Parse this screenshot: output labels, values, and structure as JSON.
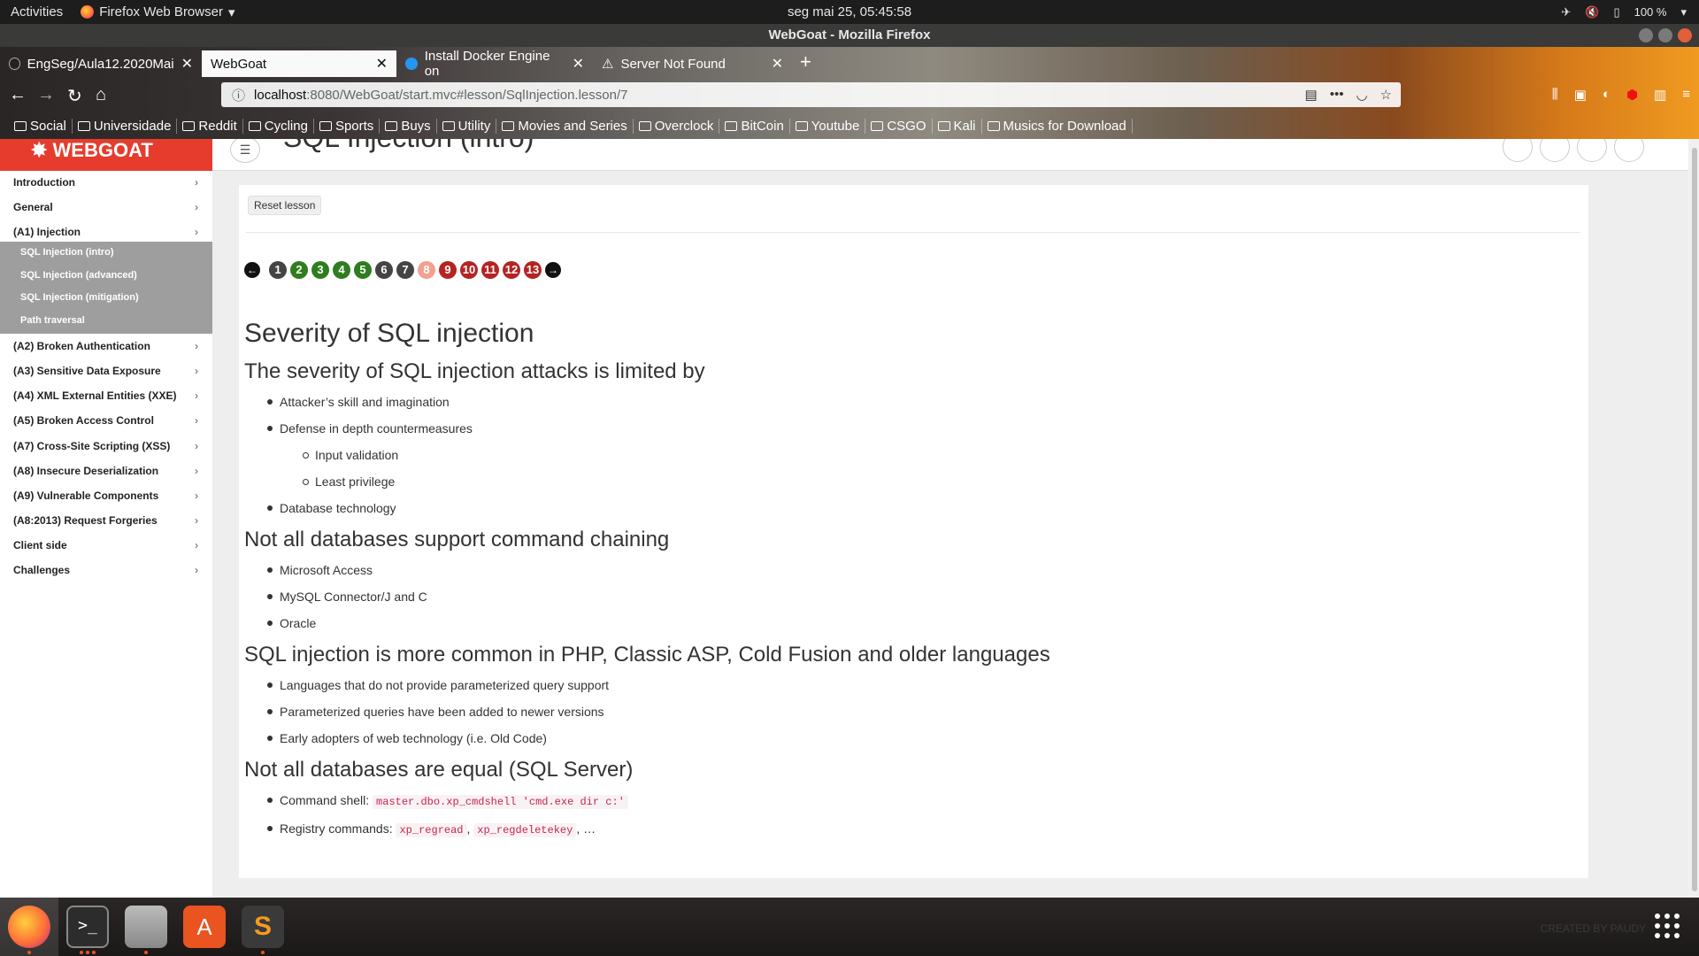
{
  "system_bar": {
    "activities": "Activities",
    "app_name": "Firefox Web Browser",
    "clock": "seg mai 25, 05:45:58",
    "battery": "100 %"
  },
  "window": {
    "title": "WebGoat - Mozilla Firefox"
  },
  "tabs": [
    {
      "label": "EngSeg/Aula12.2020Mai"
    },
    {
      "label": "WebGoat"
    },
    {
      "label": "Install Docker Engine on"
    },
    {
      "label": "Server Not Found"
    }
  ],
  "url": {
    "host": "localhost",
    "path": ":8080/WebGoat/start.mvc#lesson/SqlInjection.lesson/7"
  },
  "bookmarks": [
    "Social",
    "Universidade",
    "Reddit",
    "Cycling",
    "Sports",
    "Buys",
    "Utility",
    "Movies and Series",
    "Overclock",
    "BitCoin",
    "Youtube",
    "CSGO",
    "Kali",
    "Musics for Download"
  ],
  "sidebar": {
    "items": [
      {
        "label": "Introduction"
      },
      {
        "label": "General"
      },
      {
        "label": "(A1) Injection"
      },
      {
        "label": "(A2) Broken Authentication"
      },
      {
        "label": "(A3) Sensitive Data Exposure"
      },
      {
        "label": "(A4) XML External Entities (XXE)"
      },
      {
        "label": "(A5) Broken Access Control"
      },
      {
        "label": "(A7) Cross-Site Scripting (XSS)"
      },
      {
        "label": "(A8) Insecure Deserialization"
      },
      {
        "label": "(A9) Vulnerable Components"
      },
      {
        "label": "(A8:2013) Request Forgeries"
      },
      {
        "label": "Client side"
      },
      {
        "label": "Challenges"
      }
    ],
    "subitems": [
      {
        "label": "SQL Injection (intro)"
      },
      {
        "label": "SQL Injection (advanced)"
      },
      {
        "label": "SQL Injection (mitigation)"
      },
      {
        "label": "Path traversal"
      }
    ]
  },
  "lesson": {
    "title": "SQL Injection (intro)",
    "reset_label": "Reset lesson",
    "pages": [
      {
        "n": "1",
        "color": "#444444"
      },
      {
        "n": "2",
        "color": "#2e7d1e"
      },
      {
        "n": "3",
        "color": "#2e7d1e"
      },
      {
        "n": "4",
        "color": "#2e7d1e"
      },
      {
        "n": "5",
        "color": "#2e7d1e"
      },
      {
        "n": "6",
        "color": "#444444"
      },
      {
        "n": "7",
        "color": "#444444"
      },
      {
        "n": "8",
        "color": "#f2a08f"
      },
      {
        "n": "9",
        "color": "#b52323"
      },
      {
        "n": "10",
        "color": "#b52323"
      },
      {
        "n": "11",
        "color": "#b52323"
      },
      {
        "n": "12",
        "color": "#b52323"
      },
      {
        "n": "13",
        "color": "#b52323"
      }
    ]
  },
  "article": {
    "h2": "Severity of SQL injection",
    "s1": {
      "heading": "The severity of SQL injection attacks is limited by",
      "b1": "Attacker’s skill and imagination",
      "b2": "Defense in depth countermeasures",
      "b2a": "Input validation",
      "b2b": "Least privilege",
      "b3": "Database technology"
    },
    "s2": {
      "heading": "Not all databases support command chaining",
      "b1": "Microsoft Access",
      "b2": "MySQL Connector/J and C",
      "b3": "Oracle"
    },
    "s3": {
      "heading": "SQL injection is more common in PHP, Classic ASP, Cold Fusion and older languages",
      "b1": "Languages that do not provide parameterized query support",
      "b2": "Parameterized queries have been added to newer versions",
      "b3": "Early adopters of web technology (i.e. Old Code)"
    },
    "s4": {
      "heading": "Not all databases are equal (SQL Server)",
      "b1_label": "Command shell:",
      "b1_code": "master.dbo.xp_cmdshell 'cmd.exe dir c:'",
      "b2_label": "Registry commands:",
      "b2_code1": "xp_regread",
      "b2_sep": ",",
      "b2_code2": "xp_regdeletekey",
      "b2_tail": ", …"
    }
  },
  "dock": {
    "credit": "CREATED BY PAUDY"
  }
}
